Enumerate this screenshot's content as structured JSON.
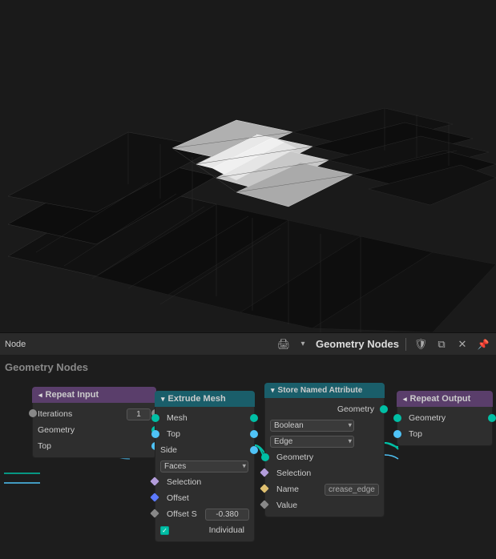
{
  "viewport": {
    "bg": "#1a1a1a"
  },
  "header": {
    "left_label": "Node",
    "title": "Geometry Nodes",
    "icons": [
      "printer",
      "dropdown",
      "shield",
      "copy",
      "close",
      "pin"
    ]
  },
  "node_editor": {
    "label": "Geometry Nodes",
    "nodes": {
      "repeat_input": {
        "title": "Repeat Input",
        "iterations_label": "Iterations",
        "iterations_value": "1",
        "geometry_label": "Geometry",
        "top_label": "Top"
      },
      "extrude_mesh": {
        "title": "Extrude Mesh",
        "mesh_label": "Mesh",
        "top_label": "Top",
        "side_label": "Side",
        "faces_label": "Faces",
        "selection_label": "Selection",
        "offset_label": "Offset",
        "offset_s_label": "Offset S",
        "offset_s_value": "-0.380",
        "individual_label": "Individual"
      },
      "store_named": {
        "title": "Store Named Attribute",
        "geometry_out_label": "Geometry",
        "boolean_label": "Boolean",
        "edge_label": "Edge",
        "geometry_in_label": "Geometry",
        "selection_label": "Selection",
        "name_label": "Name",
        "name_value": "crease_edge",
        "value_label": "Value"
      },
      "repeat_output": {
        "title": "Repeat Output",
        "geometry_label": "Geometry",
        "top_label": "Top"
      }
    }
  }
}
